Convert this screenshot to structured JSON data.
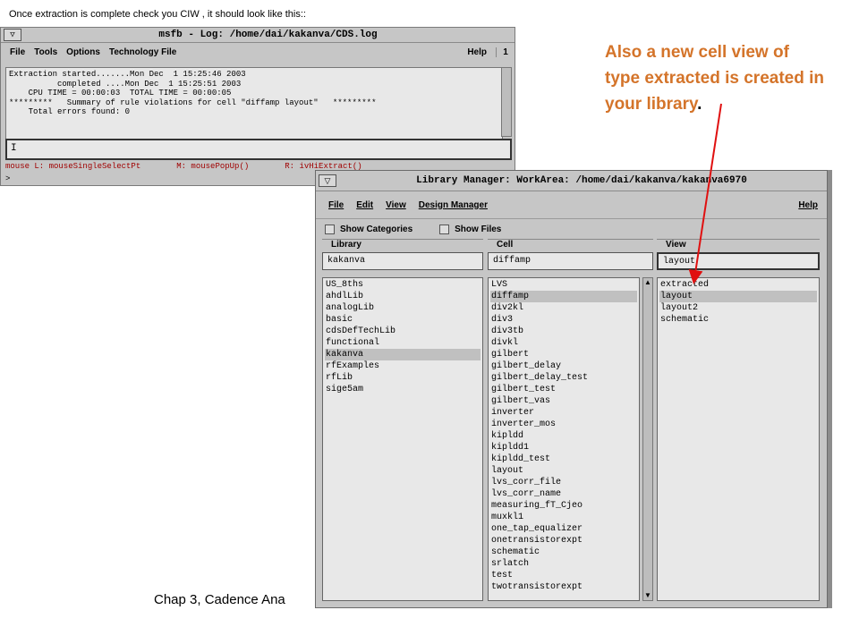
{
  "top_note": "Once extraction is complete check you CIW , it should look like this::",
  "annotation": {
    "text": "Also a new cell view of type extracted is created in your library",
    "period": ".",
    "color": "#d4742a"
  },
  "footer": "Chap 3, Cadence Ana",
  "ciw": {
    "title": "msfb - Log: /home/dai/kakanva/CDS.log",
    "menus": [
      "File",
      "Tools",
      "Options",
      "Technology File"
    ],
    "help": "Help",
    "number": "1",
    "log_lines": [
      "Extraction started.......Mon Dec  1 15:25:46 2003",
      "          completed ....Mon Dec  1 15:25:51 2003",
      "    CPU TIME = 00:00:03  TOTAL TIME = 00:00:05",
      "*********   Summary of rule violations for cell \"diffamp layout\"   *********",
      "    Total errors found: 0"
    ],
    "input_value": "I",
    "status": {
      "left": "mouse L: mouseSingleSelectPt",
      "middle": "M: mousePopUp()",
      "right": "R: ivHiExtract()"
    },
    "prompt": ">"
  },
  "library_manager": {
    "title": "Library Manager: WorkArea: /home/dai/kakanva/kakanva6970",
    "menus": [
      "File",
      "Edit",
      "View",
      "Design Manager"
    ],
    "help": "Help",
    "show_categories": "Show Categories",
    "show_files": "Show Files",
    "library": {
      "label": "Library",
      "value": "kakanva",
      "items": [
        "US_8ths",
        "ahdlLib",
        "analogLib",
        "basic",
        "cdsDefTechLib",
        "functional",
        "kakanva",
        "rfExamples",
        "rfLib",
        "sige5am"
      ],
      "selected": "kakanva"
    },
    "cell": {
      "label": "Cell",
      "value": "diffamp",
      "items": [
        "LVS",
        "diffamp",
        "div2kl",
        "div3",
        "div3tb",
        "divkl",
        "gilbert",
        "gilbert_delay",
        "gilbert_delay_test",
        "gilbert_test",
        "gilbert_vas",
        "inverter",
        "inverter_mos",
        "kipldd",
        "kipldd1",
        "kipldd_test",
        "layout",
        "lvs_corr_file",
        "lvs_corr_name",
        "measuring_fT_Cjeo",
        "muxkl1",
        "one_tap_equalizer",
        "onetransistorexpt",
        "schematic",
        "srlatch",
        "test",
        "twotransistorexpt"
      ],
      "selected": "diffamp"
    },
    "view": {
      "label": "View",
      "value": "layout",
      "items": [
        "extracted",
        "layout",
        "layout2",
        "schematic"
      ],
      "selected": "layout"
    }
  }
}
